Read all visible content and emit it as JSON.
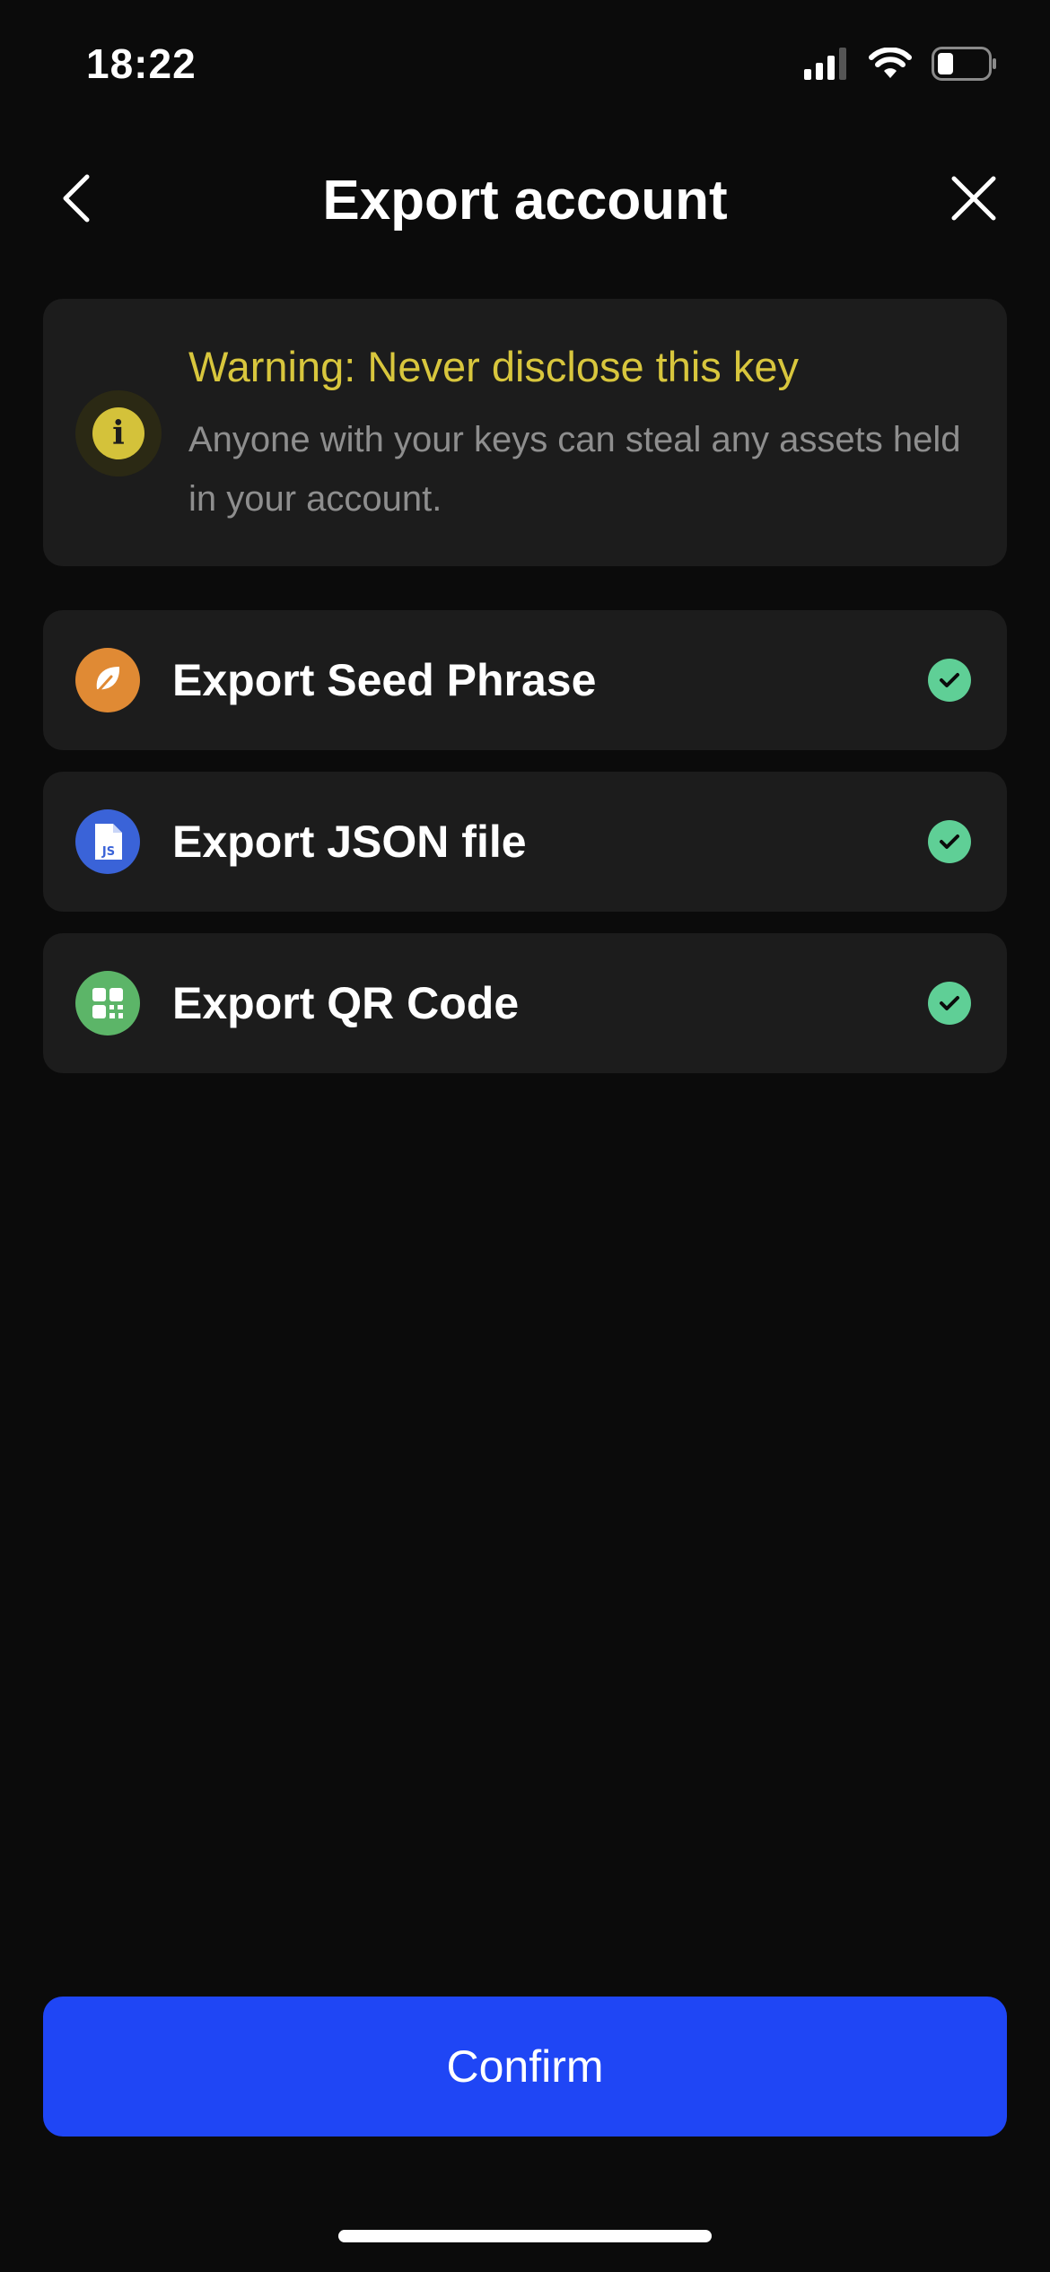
{
  "status_bar": {
    "time": "18:22",
    "icons": [
      "signal-icon",
      "wifi-icon",
      "battery-icon"
    ]
  },
  "header": {
    "title": "Export account",
    "back_icon": "chevron-left-icon",
    "close_icon": "close-icon"
  },
  "warning": {
    "title": "Warning: Never disclose this key",
    "text": "Anyone with your keys can steal any assets held in your account.",
    "icon": "info-icon",
    "color": "#d8c63d"
  },
  "options": [
    {
      "label": "Export Seed Phrase",
      "icon": "leaf-icon",
      "icon_color": "#e08a34",
      "checked": true
    },
    {
      "label": "Export JSON file",
      "icon": "json-file-icon",
      "icon_color": "#3a63d8",
      "checked": true
    },
    {
      "label": "Export QR Code",
      "icon": "qr-code-icon",
      "icon_color": "#5cb568",
      "checked": true
    }
  ],
  "check_color": "#5fcf96",
  "confirm": {
    "label": "Confirm",
    "color": "#1f46f5"
  }
}
